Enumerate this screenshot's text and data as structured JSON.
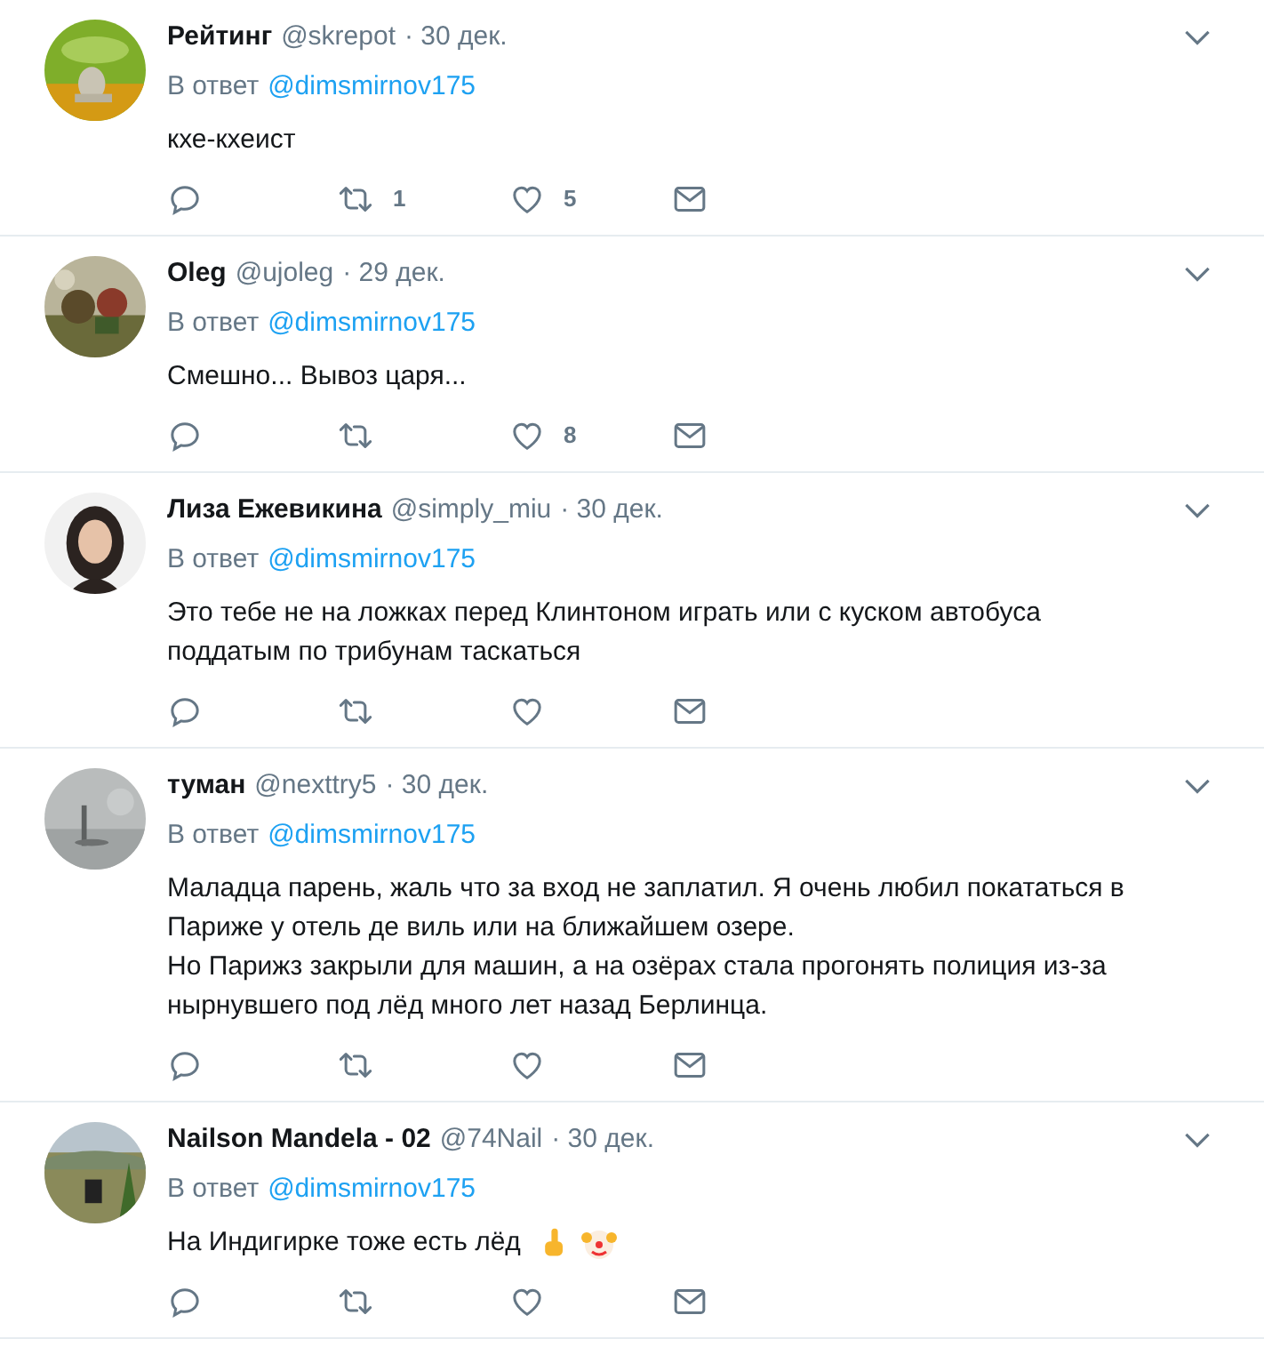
{
  "tweets": [
    {
      "name": "Рейтинг",
      "handle": "@skrepot",
      "date": "· 30 дек.",
      "reply_prefix": "В ответ",
      "reply_to": "@dimsmirnov175",
      "lines": [
        "кхе-кхеист"
      ],
      "retweets": "1",
      "likes": "5"
    },
    {
      "name": "Oleg",
      "handle": "@ujoleg",
      "date": "· 29 дек.",
      "reply_prefix": "В ответ",
      "reply_to": "@dimsmirnov175",
      "lines": [
        "Смешно... Вывоз царя..."
      ],
      "likes": "8"
    },
    {
      "name": "Лиза Ежевикина",
      "handle": "@simply_miu",
      "date": "· 30 дек.",
      "reply_prefix": "В ответ",
      "reply_to": "@dimsmirnov175",
      "lines": [
        "Это тебе не на ложках перед Клинтоном играть или с куском автобуса поддатым по трибунам таскаться"
      ]
    },
    {
      "name": "туман",
      "handle": "@nexttry5",
      "date": "· 30 дек.",
      "reply_prefix": "В ответ",
      "reply_to": "@dimsmirnov175",
      "lines": [
        "Маладца парень, жаль что за вход не заплатил. Я очень любил покататься в Париже у отель де виль или на ближайшем озере.",
        "Но Парижз закрыли для машин, а на озёрах стала прогонять полиция из-за нырнувшего под лёд много лет назад Берлинца."
      ]
    },
    {
      "name": "Nailson Mandela - 02",
      "handle": "@74Nail",
      "date": "· 30 дек.",
      "reply_prefix": "В ответ",
      "reply_to": "@dimsmirnov175",
      "lines": [
        "На Индигирке тоже есть лёд"
      ],
      "emoji": true
    }
  ]
}
